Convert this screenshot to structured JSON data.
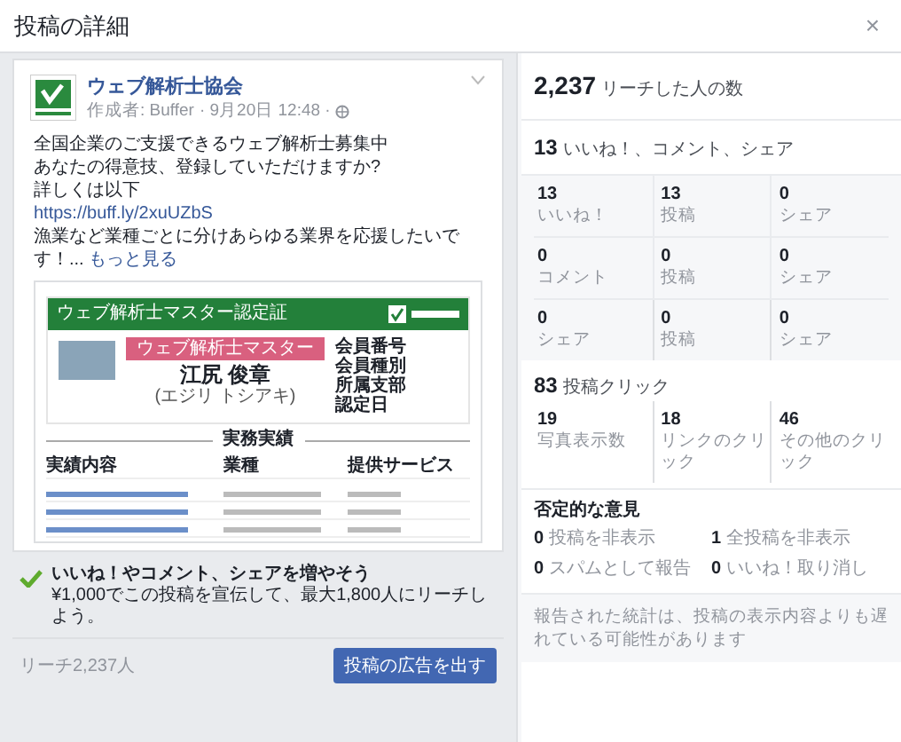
{
  "dialog": {
    "title": "投稿の詳細",
    "close": "×"
  },
  "post": {
    "page_name": "ウェブ解析士協会",
    "author": "作成者: Buffer",
    "date": "· 9月20日 12:48 ·",
    "lines": [
      "全国企業のご支援できるウェブ解析士募集中",
      "あなたの得意技、登録していただけますか?",
      "詳しくは以下"
    ],
    "link": "https://buff.ly/2xuUZbS",
    "last_line": "漁業など業種ごとに分けあらゆる業界を応援したいです！...",
    "see_more": "もっと見る"
  },
  "preview": {
    "certificate_title": "ウェブ解析士マスター認定証",
    "badge": "ウェブ解析士マスター",
    "person_name": "江尻 俊章",
    "person_kana": "(エジリ トシアキ)",
    "fields": [
      "会員番号",
      "会員種別",
      "所属支部",
      "認定日"
    ],
    "section_title": "実務実績",
    "columns": [
      "実績内容",
      "業種",
      "提供サービス"
    ]
  },
  "boost": {
    "title": "いいね！やコメント、シェアを増やそう",
    "text": "¥1,000でこの投稿を宣伝して、最大1,800人にリーチしよう。",
    "reach": "リーチ2,237人",
    "button": "投稿の広告を出す"
  },
  "insights": {
    "reach": {
      "value": "2,237",
      "label": "リーチした人の数"
    },
    "engagement": {
      "value": "13",
      "label": "いいね！、コメント、シェア"
    },
    "engagement_grid": [
      {
        "value": "13",
        "label": "いいね！"
      },
      {
        "value": "13",
        "label": "投稿"
      },
      {
        "value": "0",
        "label": "シェア"
      },
      {
        "value": "0",
        "label": "コメント"
      },
      {
        "value": "0",
        "label": "投稿"
      },
      {
        "value": "0",
        "label": "シェア"
      },
      {
        "value": "0",
        "label": "シェア"
      },
      {
        "value": "0",
        "label": "投稿"
      },
      {
        "value": "0",
        "label": "シェア"
      }
    ],
    "clicks": {
      "value": "83",
      "label": "投稿クリック"
    },
    "click_grid": [
      {
        "value": "19",
        "label": "写真表示数"
      },
      {
        "value": "18",
        "label": "リンクのクリック"
      },
      {
        "value": "46",
        "label": "その他のクリック"
      }
    ],
    "negative": {
      "title": "否定的な意見",
      "items": [
        "**0** 投稿を非表示",
        "**1** 全投稿を非表示",
        "**0** スパムとして報告",
        "**0** いいね！取り消し"
      ]
    },
    "note": "報告された統計は、投稿の表示内容よりも遅れている可能性があります"
  }
}
